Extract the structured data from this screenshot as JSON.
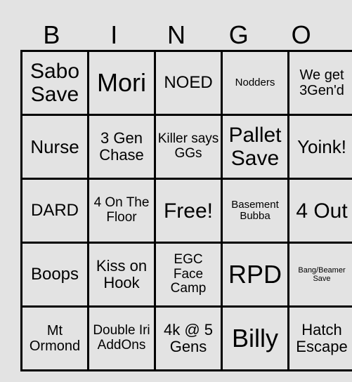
{
  "header": {
    "letters": [
      "B",
      "I",
      "N",
      "G",
      "O"
    ]
  },
  "board": {
    "rows": [
      [
        "Sabo Save",
        "Mori",
        "NOED",
        "Nodders",
        "We get 3Gen'd"
      ],
      [
        "Nurse",
        "3 Gen Chase",
        "Killer says GGs",
        "Pallet Save",
        "Yoink!"
      ],
      [
        "DARD",
        "4 On The Floor",
        "Free!",
        "Basement Bubba",
        "4 Out"
      ],
      [
        "Boops",
        "Kiss on Hook",
        "EGC Face Camp",
        "RPD",
        "Bang/Beamer Save"
      ],
      [
        "Mt Ormond",
        "Double Iri AddOns",
        "4k @ 5 Gens",
        "Billy",
        "Hatch Escape"
      ]
    ]
  }
}
